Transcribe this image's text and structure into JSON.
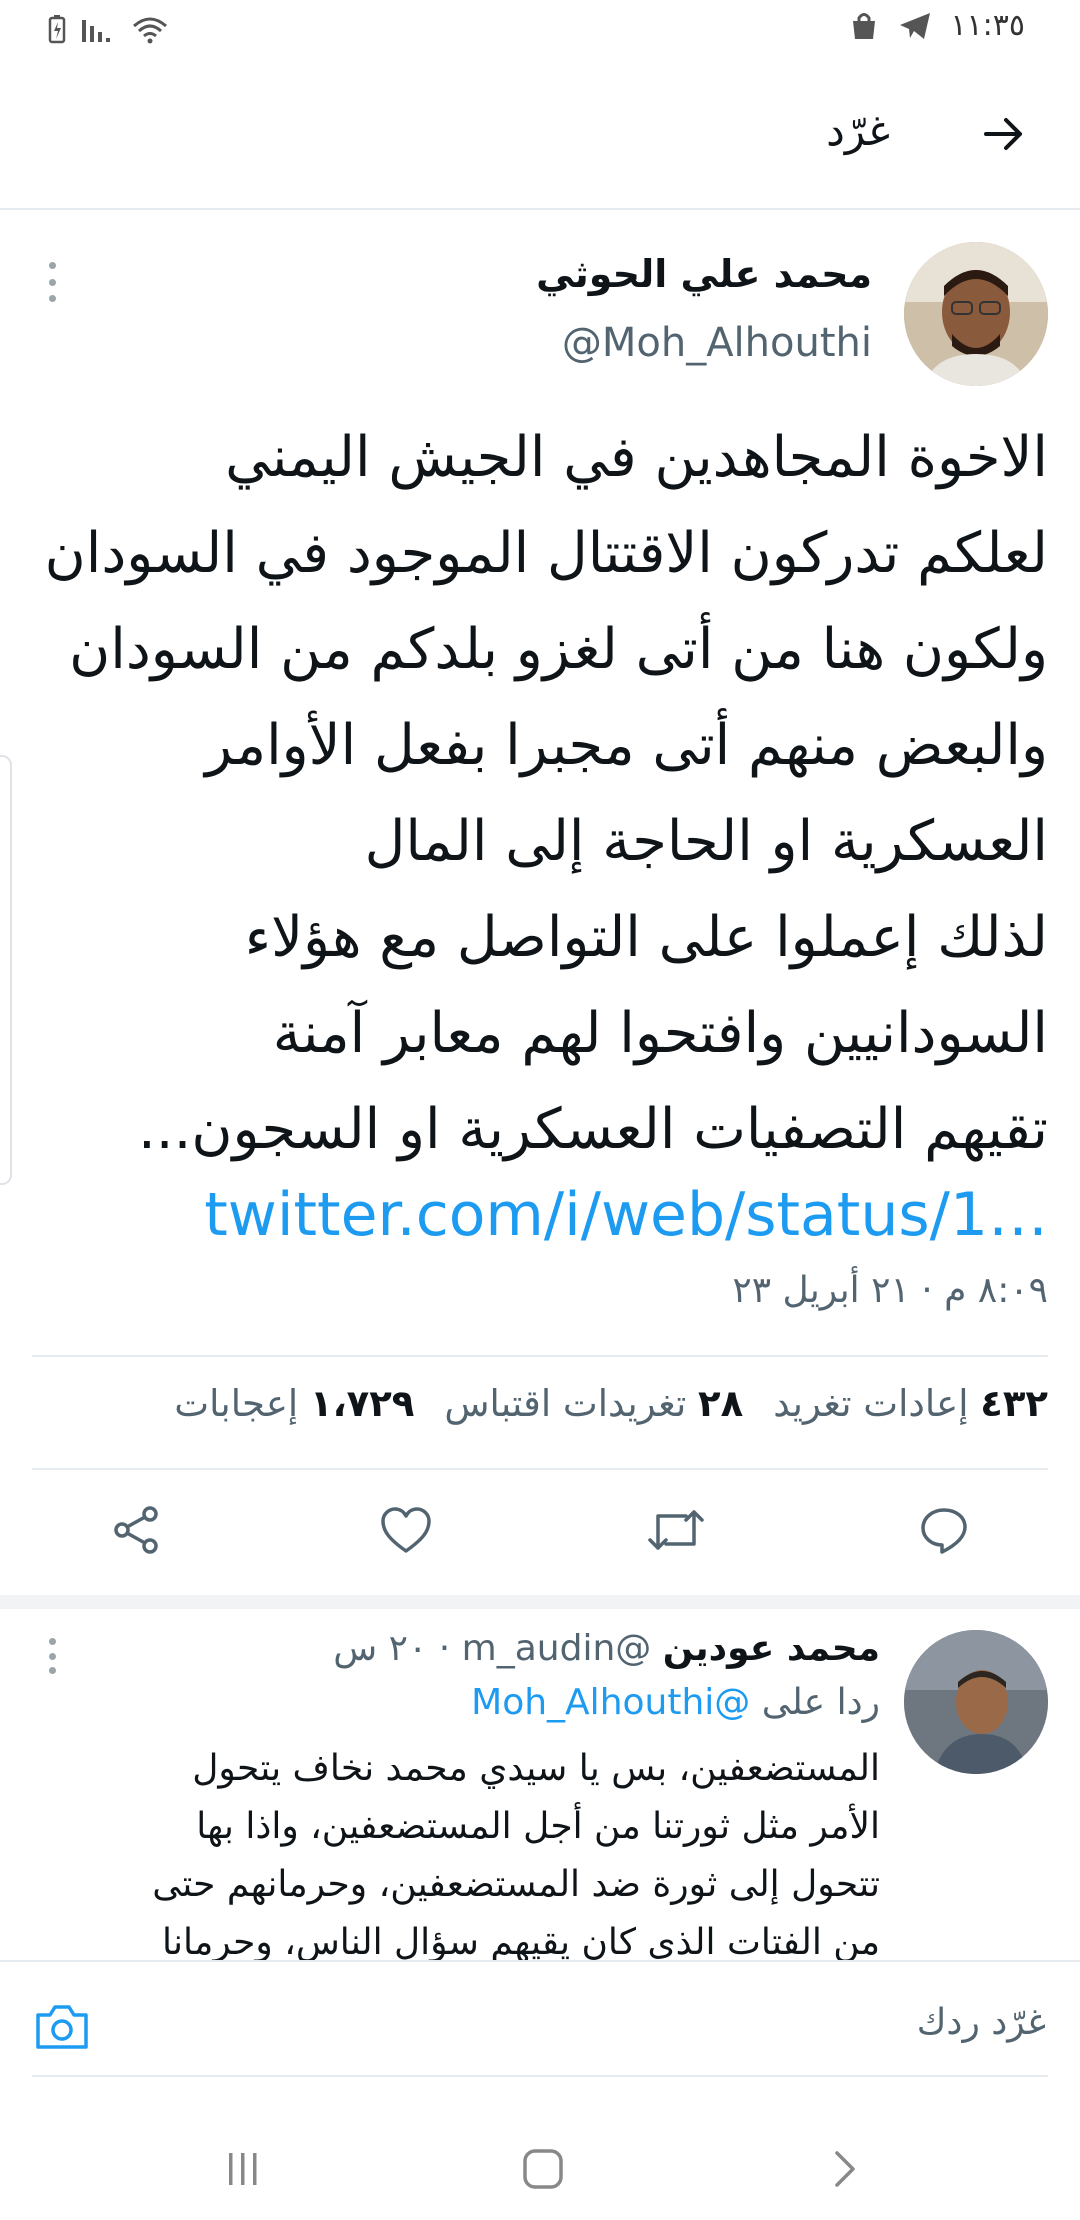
{
  "status_bar": {
    "time": "١١:٣٥"
  },
  "header": {
    "title": "غرّد"
  },
  "tweet": {
    "display_name": "محمد علي الحوثي",
    "handle": "@Moh_Alhouthi",
    "text_lines": [
      "الاخوة المجاهدين في الجيش اليمني",
      "لعلكم تدركون الاقتتال الموجود في السودان",
      "ولكون هنا من أتى لغزو بلدكم من السودان",
      "والبعض منهم أتى مجبرا بفعل الأوامر",
      "العسكرية او الحاجة إلى المال",
      "لذلك إعملوا على التواصل مع هؤلاء",
      "السودانيين وافتحوا لهم معابر آمنة",
      "تقيهم التصفيات العسكرية او السجون..."
    ],
    "link": "twitter.com/i/web/status/1…",
    "timestamp": "٨:٠٩ م · ٢١ أبريل ٢٣",
    "stats": {
      "retweets_count": "٤٣٢",
      "retweets_label": "إعادات تغريد",
      "quotes_count": "٢٨",
      "quotes_label": "تغريدات اقتباس",
      "likes_count": "١،٧٢٩",
      "likes_label": "إعجابات"
    }
  },
  "reply": {
    "display_name": "محمد عودين",
    "handle": "@m_audin",
    "time": "٢٠ س",
    "reply_to_label": "ردا على",
    "reply_to_handle": "@Moh_Alhouthi",
    "text_lines": [
      "المستضعفين، بس يا سيدي محمد نخاف يتحول",
      "الأمر مثل ثورتنا من أجل المستضعفين، واذا بها",
      "تتحول إلى ثورة ضد المستضعفين، وحرمانهم حتى",
      "من الفتات الذي كان يقيهم سؤال الناس، وحرمانا"
    ]
  },
  "compose": {
    "placeholder": "غرّد ردك"
  },
  "colors": {
    "link": "#1d9bf0",
    "secondary_text": "#536471",
    "divider": "#e6ecf0"
  },
  "icons": [
    "arrow-right-icon",
    "more-vert-icon",
    "reply-icon",
    "retweet-icon",
    "like-icon",
    "share-icon",
    "camera-icon",
    "recent-apps-icon",
    "home-icon",
    "back-nav-icon"
  ]
}
